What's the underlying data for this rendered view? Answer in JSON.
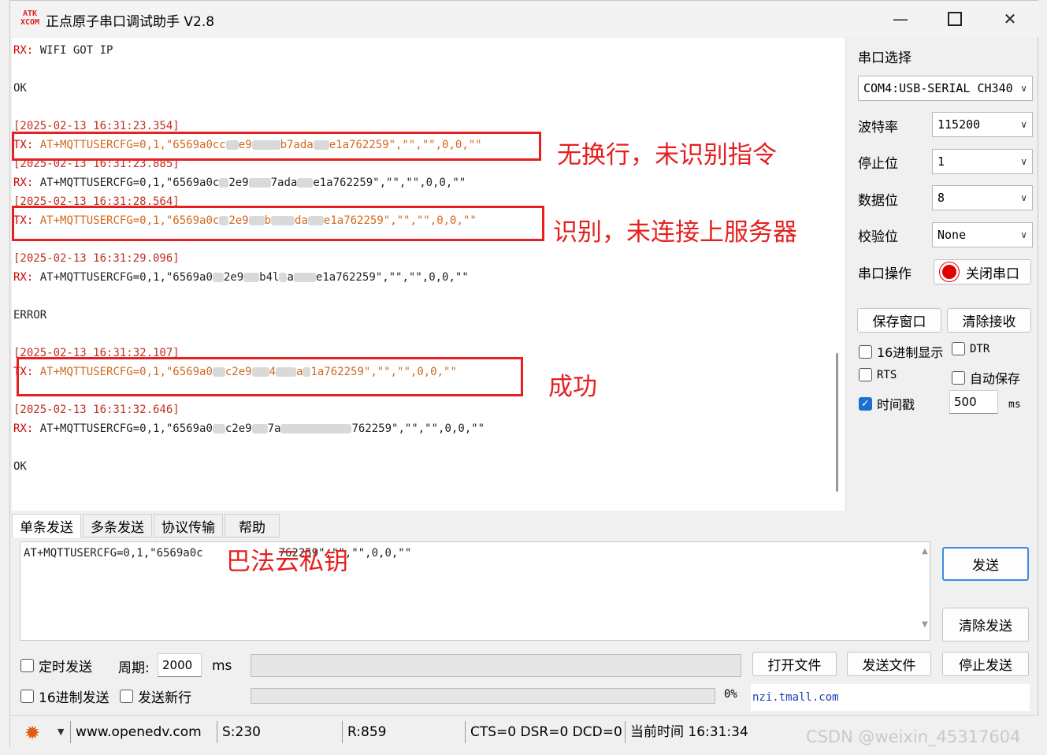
{
  "window": {
    "logo_text_1": "ATK",
    "logo_text_2": "XCOM",
    "title": "正点原子串口调试助手 V2.8"
  },
  "receive": {
    "lines": [
      {
        "prefix": "RX:",
        "text": " WIFI GOT IP"
      },
      {
        "prefix": "",
        "text": "OK"
      },
      {
        "prefix": "",
        "text": "[2025-02-13 16:31:23.354]"
      },
      {
        "prefix": "TX:",
        "text": " AT+MQTTUSERCFG=0,1,\"6569a0cc",
        "tail": "e9",
        "tail2": "b7ada",
        "tail3": "e1a762259\",\"\",\"\",0,0,\"\""
      },
      {
        "prefix": "",
        "text": "[2025-02-13 16:31:23.885]"
      },
      {
        "prefix": "RX:",
        "text": " AT+MQTTUSERCFG=0,1,\"6569a0c",
        "tail": "2e9",
        "tail2": "7ada",
        "tail3": "e1a762259\",\"\",\"\",0,0,\"\""
      },
      {
        "prefix": "",
        "text": "[2025-02-13 16:31:28.564]"
      },
      {
        "prefix": "TX:",
        "text": " AT+MQTTUSERCFG=0,1,\"6569a0c",
        "tail": "2e9",
        "tail2": "b",
        "tail3": "da",
        "tail4": "e1a762259\",\"\",\"\",0,0,\"\""
      },
      {
        "prefix": "",
        "text": "[2025-02-13 16:31:29.096]"
      },
      {
        "prefix": "RX:",
        "text": " AT+MQTTUSERCFG=0,1,\"6569a0",
        "tail": "2e9",
        "tail2": "b4l",
        "tail3": "a",
        "tail4": "e1a762259\",\"\",\"\",0,0,\"\""
      },
      {
        "prefix": "",
        "text": "ERROR"
      },
      {
        "prefix": "",
        "text": "[2025-02-13 16:31:32.107]"
      },
      {
        "prefix": "TX:",
        "text": " AT+MQTTUSERCFG=0,1,\"6569a0",
        "tail": "c2e9",
        "tail2": "4",
        "tail3": "a",
        "tail4": "1a762259\",\"\",\"\",0,0,\"\""
      },
      {
        "prefix": "",
        "text": "[2025-02-13 16:31:32.646]"
      },
      {
        "prefix": "RX:",
        "text": " AT+MQTTUSERCFG=0,1,\"6569a0",
        "tail": "c2e9",
        "tail2": "7a",
        "tail3": "762259\",\"\",\"\",0,0,\"\""
      },
      {
        "prefix": "",
        "text": "OK"
      }
    ]
  },
  "annotations": {
    "a1": "无换行，未识别指令",
    "a2": "识别，未连接上服务器",
    "a3": "成功",
    "a4": "巴法云私钥",
    "color": "#e62020"
  },
  "settings": {
    "port_label": "串口选择",
    "port_value": "COM4:USB-SERIAL CH340",
    "baud_label": "波特率",
    "baud_value": "115200",
    "stop_label": "停止位",
    "stop_value": "1",
    "data_label": "数据位",
    "data_value": "8",
    "parity_label": "校验位",
    "parity_value": "None",
    "op_label": "串口操作",
    "op_button": "关闭串口",
    "save_window": "保存窗口",
    "clear_recv": "清除接收",
    "hex_display": "16进制显示",
    "dtr": "DTR",
    "rts": "RTS",
    "auto_save": "自动保存",
    "timestamp": "时间戳",
    "timestamp_value": "500",
    "ms": "ms"
  },
  "tabs": [
    "单条发送",
    "多条发送",
    "协议传输",
    "帮助"
  ],
  "send": {
    "text_head": "AT+MQTTUSERCFG=0,1,\"6569a0c",
    "text_tail": "762259\",\"\",\"\",0,0,\"\"",
    "send_button": "发送",
    "clear_send": "清除发送",
    "timed_send": "定时发送",
    "period_label": "周期:",
    "period_value": "2000",
    "period_unit": "ms",
    "open_file": "打开文件",
    "send_file": "发送文件",
    "stop_send": "停止发送",
    "hex_send": "16进制发送",
    "send_newline": "发送新行",
    "progress_text": "0%",
    "link_text": "nzi.tmall.com"
  },
  "status": {
    "website": "www.openedv.com",
    "sent": "S:230",
    "received": "R:859",
    "lines": "CTS=0 DSR=0 DCD=0",
    "time": "当前时间 16:31:34"
  },
  "watermark": "CSDN @weixin_45317604"
}
